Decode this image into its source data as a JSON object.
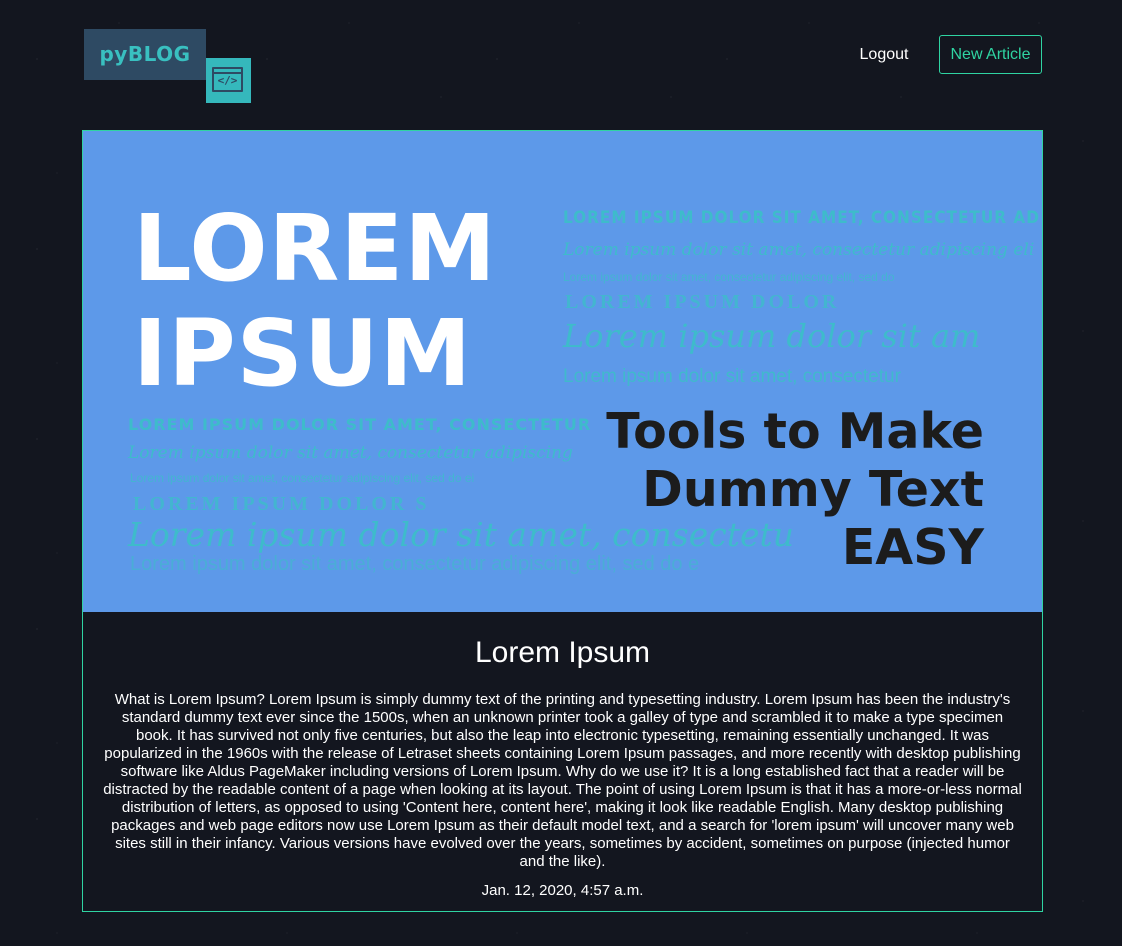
{
  "header": {
    "logo_text": "pyBLOG",
    "logo_icon_glyph": "</>",
    "nav": {
      "logout_label": "Logout",
      "new_article_label": "New Article"
    }
  },
  "article": {
    "hero": {
      "big_line_1": "LOREM",
      "big_line_2": "IPSUM",
      "right_lines": [
        "LOREM IPSUM DOLOR SIT AMET, CONSECTETUR AD",
        "Lorem ipsum dolor sit amet, consectetur adipiscing eli",
        "Lorem ipsum dolor sit amet, consectetur adipiscing elit, sed do",
        "LOREM IPSUM DOLOR",
        "Lorem ipsum dolor sit am",
        "Lorem ipsum dolor sit amet, consectetur"
      ],
      "left_lines": [
        "LOREM IPSUM DOLOR SIT AMET, CONSECTETUR",
        "Lorem ipsum dolor sit amet, consectetur adipiscing",
        "Lorem ipsum dolor sit amet, consectetur adipiscing elit, sed do ei",
        "LOREM IPSUM DOLOR S",
        "Lorem ipsum dolor sit amet, consectetu",
        "Lorem ipsum dolor sit amet, consectetur adipiscing elit, sed do e"
      ],
      "tagline": [
        "Tools to Make",
        "Dummy Text",
        "EASY"
      ]
    },
    "title": "Lorem Ipsum",
    "body": "What is Lorem Ipsum? Lorem Ipsum is simply dummy text of the printing and typesetting industry. Lorem Ipsum has been the industry's standard dummy text ever since the 1500s, when an unknown printer took a galley of type and scrambled it to make a type specimen book. It has survived not only five centuries, but also the leap into electronic typesetting, remaining essentially unchanged. It was popularized in the 1960s with the release of Letraset sheets containing Lorem Ipsum passages, and more recently with desktop publishing software like Aldus PageMaker including versions of Lorem Ipsum. Why do we use it? It is a long established fact that a reader will be distracted by the readable content of a page when looking at its layout. The point of using Lorem Ipsum is that it has a more-or-less normal distribution of letters, as opposed to using 'Content here, content here', making it look like readable English. Many desktop publishing packages and web page editors now use Lorem Ipsum as their default model text, and a search for 'lorem ipsum' will uncover many web sites still in their infancy. Various versions have evolved over the years, sometimes by accident, sometimes on purpose (injected humor and the like).",
    "date": "Jan. 12, 2020, 4:57 a.m."
  },
  "colors": {
    "page_background": "#13161f",
    "accent_green": "#2fd4a2",
    "logo_bg": "#2e4a63",
    "logo_teal": "#35b8bc",
    "hero_blue": "#5d99e9",
    "hero_text_dark": "#1c1c1c"
  },
  "icons": {
    "logo_icon": "code-window-icon"
  }
}
